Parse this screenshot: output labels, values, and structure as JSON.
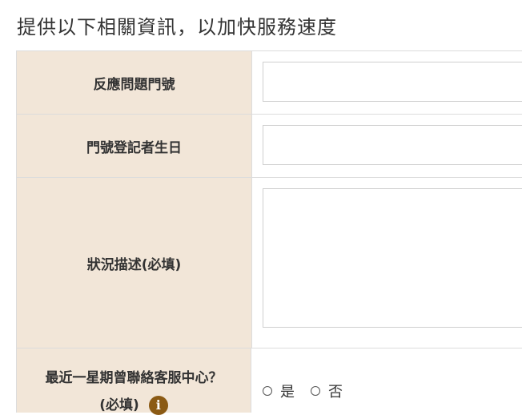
{
  "heading": "提供以下相關資訊，以加快服務速度",
  "fields": {
    "ticket_number": {
      "label": "反應問題門號",
      "value": ""
    },
    "birthday": {
      "label": "門號登記者生日",
      "value": ""
    },
    "description": {
      "label": "狀況描述(必填)",
      "value": ""
    },
    "contacted": {
      "label_line1": "最近一星期曾聯絡客服中心？",
      "label_line2": "(必填)",
      "info_icon": "info-icon",
      "options": {
        "yes": "是",
        "no": "否"
      },
      "selected": ""
    }
  },
  "colors": {
    "label_bg": "#f2e6d8",
    "info_icon": "#8b5a14"
  }
}
